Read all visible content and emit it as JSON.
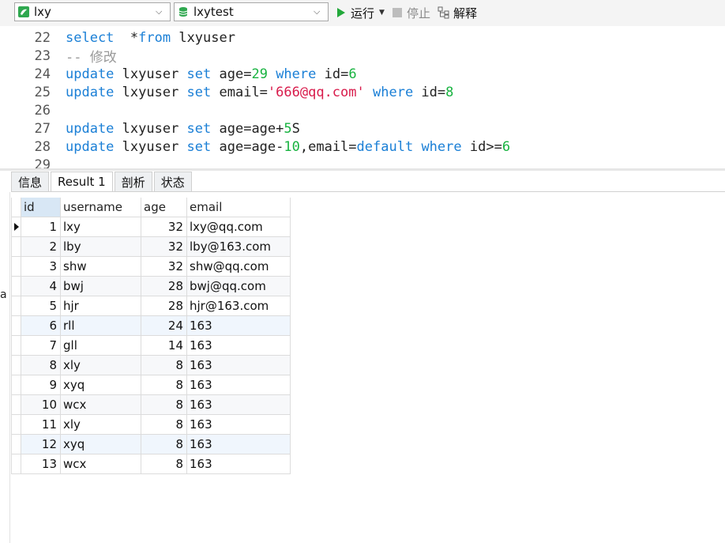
{
  "toolbar": {
    "connection": "lxy",
    "database": "lxytest",
    "run_label": "运行",
    "stop_label": "停止",
    "explain_label": "解释"
  },
  "editor": {
    "lines": [
      {
        "num": "22",
        "tokens": [
          [
            "kw",
            "select"
          ],
          [
            "",
            "  *"
          ],
          [
            "kw",
            "from"
          ],
          [
            "",
            " lxyuser"
          ]
        ]
      },
      {
        "num": "23",
        "tokens": [
          [
            "cmt",
            "-- 修改"
          ]
        ]
      },
      {
        "num": "24",
        "tokens": [
          [
            "kw",
            "update"
          ],
          [
            "",
            " lxyuser "
          ],
          [
            "kw",
            "set"
          ],
          [
            "",
            " age="
          ],
          [
            "num",
            "29"
          ],
          [
            "",
            " "
          ],
          [
            "kw",
            "where"
          ],
          [
            "",
            " id="
          ],
          [
            "num",
            "6"
          ]
        ]
      },
      {
        "num": "25",
        "tokens": [
          [
            "kw",
            "update"
          ],
          [
            "",
            " lxyuser "
          ],
          [
            "kw",
            "set"
          ],
          [
            "",
            " email="
          ],
          [
            "str",
            "'666@qq.com'"
          ],
          [
            "",
            " "
          ],
          [
            "kw",
            "where"
          ],
          [
            "",
            " id="
          ],
          [
            "num",
            "8"
          ]
        ]
      },
      {
        "num": "26",
        "tokens": []
      },
      {
        "num": "27",
        "tokens": [
          [
            "kw",
            "update"
          ],
          [
            "",
            " lxyuser "
          ],
          [
            "kw",
            "set"
          ],
          [
            "",
            " age=age+"
          ],
          [
            "num",
            "5"
          ],
          [
            "",
            "S"
          ]
        ]
      },
      {
        "num": "28",
        "tokens": [
          [
            "kw",
            "update"
          ],
          [
            "",
            " lxyuser "
          ],
          [
            "kw",
            "set"
          ],
          [
            "",
            " age=age-"
          ],
          [
            "num",
            "10"
          ],
          [
            "",
            ",email="
          ],
          [
            "kw",
            "default"
          ],
          [
            "",
            " "
          ],
          [
            "kw",
            "where"
          ],
          [
            "",
            " id>="
          ],
          [
            "num",
            "6"
          ]
        ]
      },
      {
        "num": "29",
        "tokens": []
      }
    ]
  },
  "tabs": [
    "信息",
    "Result 1",
    "剖析",
    "状态"
  ],
  "active_tab": 1,
  "left_edge_text": "a",
  "result": {
    "columns": [
      "id",
      "username",
      "age",
      "email"
    ],
    "rows": [
      [
        "1",
        "lxy",
        "32",
        "lxy@qq.com"
      ],
      [
        "2",
        "lby",
        "32",
        "lby@163.com"
      ],
      [
        "3",
        "shw",
        "32",
        "shw@qq.com"
      ],
      [
        "4",
        "bwj",
        "28",
        "bwj@qq.com"
      ],
      [
        "5",
        "hjr",
        "28",
        "hjr@163.com"
      ],
      [
        "6",
        "rll",
        "24",
        "163"
      ],
      [
        "7",
        "gll",
        "14",
        "163"
      ],
      [
        "8",
        "xly",
        "8",
        "163"
      ],
      [
        "9",
        "xyq",
        "8",
        "163"
      ],
      [
        "10",
        "wcx",
        "8",
        "163"
      ],
      [
        "11",
        "xly",
        "8",
        "163"
      ],
      [
        "12",
        "xyq",
        "8",
        "163"
      ],
      [
        "13",
        "wcx",
        "8",
        "163"
      ]
    ]
  },
  "colors": {
    "keyword": "#1a7fd6",
    "number": "#18b340",
    "string": "#d81b4b",
    "comment": "#9a9a9a",
    "run_green": "#22a83a"
  }
}
